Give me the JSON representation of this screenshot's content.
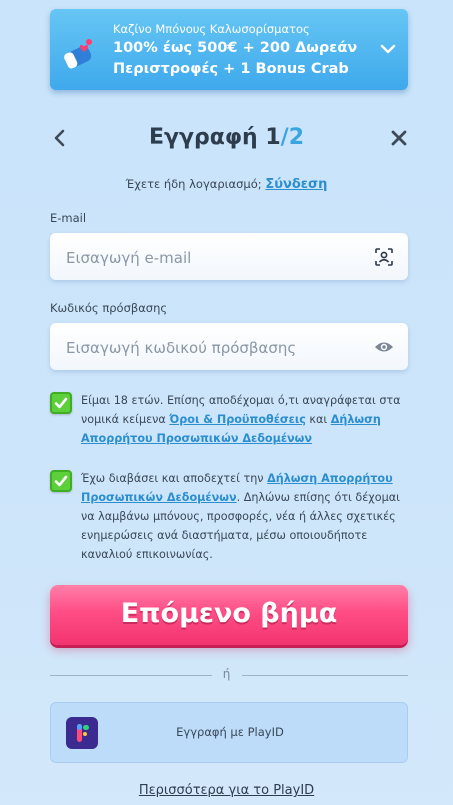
{
  "banner": {
    "subtitle": "Καζίνο Μπόνους Καλωσορίσματος",
    "title": "100% έως 500€ + 200 Δωρεάν Περιστροφές + 1 Bonus Crab",
    "icon": "magnet-gift-icon"
  },
  "header": {
    "title_main": "Εγγραφή 1",
    "title_sep": "/",
    "title_total": "2"
  },
  "login": {
    "prompt": "Έχετε ήδη λογαριασμό;",
    "link": "Σύνδεση"
  },
  "email": {
    "label": "E-mail",
    "placeholder": "Εισαγωγή e-mail",
    "value": ""
  },
  "password": {
    "label": "Κωδικός πρόσβασης",
    "placeholder": "Εισαγωγή κωδικού πρόσβασης",
    "value": ""
  },
  "consent1": {
    "checked": true,
    "text_before": "Είμαι 18 ετών. Επίσης αποδέχομαι ό,τι αναγράφεται στα νομικά κείμενα ",
    "link1": "Όροι & Προϋποθέσεις",
    "text_mid": " και ",
    "link2": "Δήλωση Απορρήτου Προσωπικών Δεδομένων"
  },
  "consent2": {
    "checked": true,
    "text_before": "Έχω διαβάσει και αποδεχτεί την ",
    "link1": "Δήλωση Απορρήτου Προσωπικών Δεδομένων",
    "text_after": ". Δηλώνω επίσης ότι δέχομαι να λαμβάνω μπόνους, προσφορές, νέα ή άλλες σχετικές ενημερώσεις ανά διαστήματα, μέσω οποιουδήποτε καναλιού επικοινωνίας."
  },
  "next_button": "Επόμενο βήμα",
  "divider": "ή",
  "playid": {
    "label": "Εγγραφή με PlayID"
  },
  "more_link": "Περισσότερα για το PlayID",
  "colors": {
    "accent": "#3aa5e0",
    "primary_button": "#ff4d86",
    "checkbox": "#5ccf3a",
    "banner": "#3fa9ec"
  }
}
